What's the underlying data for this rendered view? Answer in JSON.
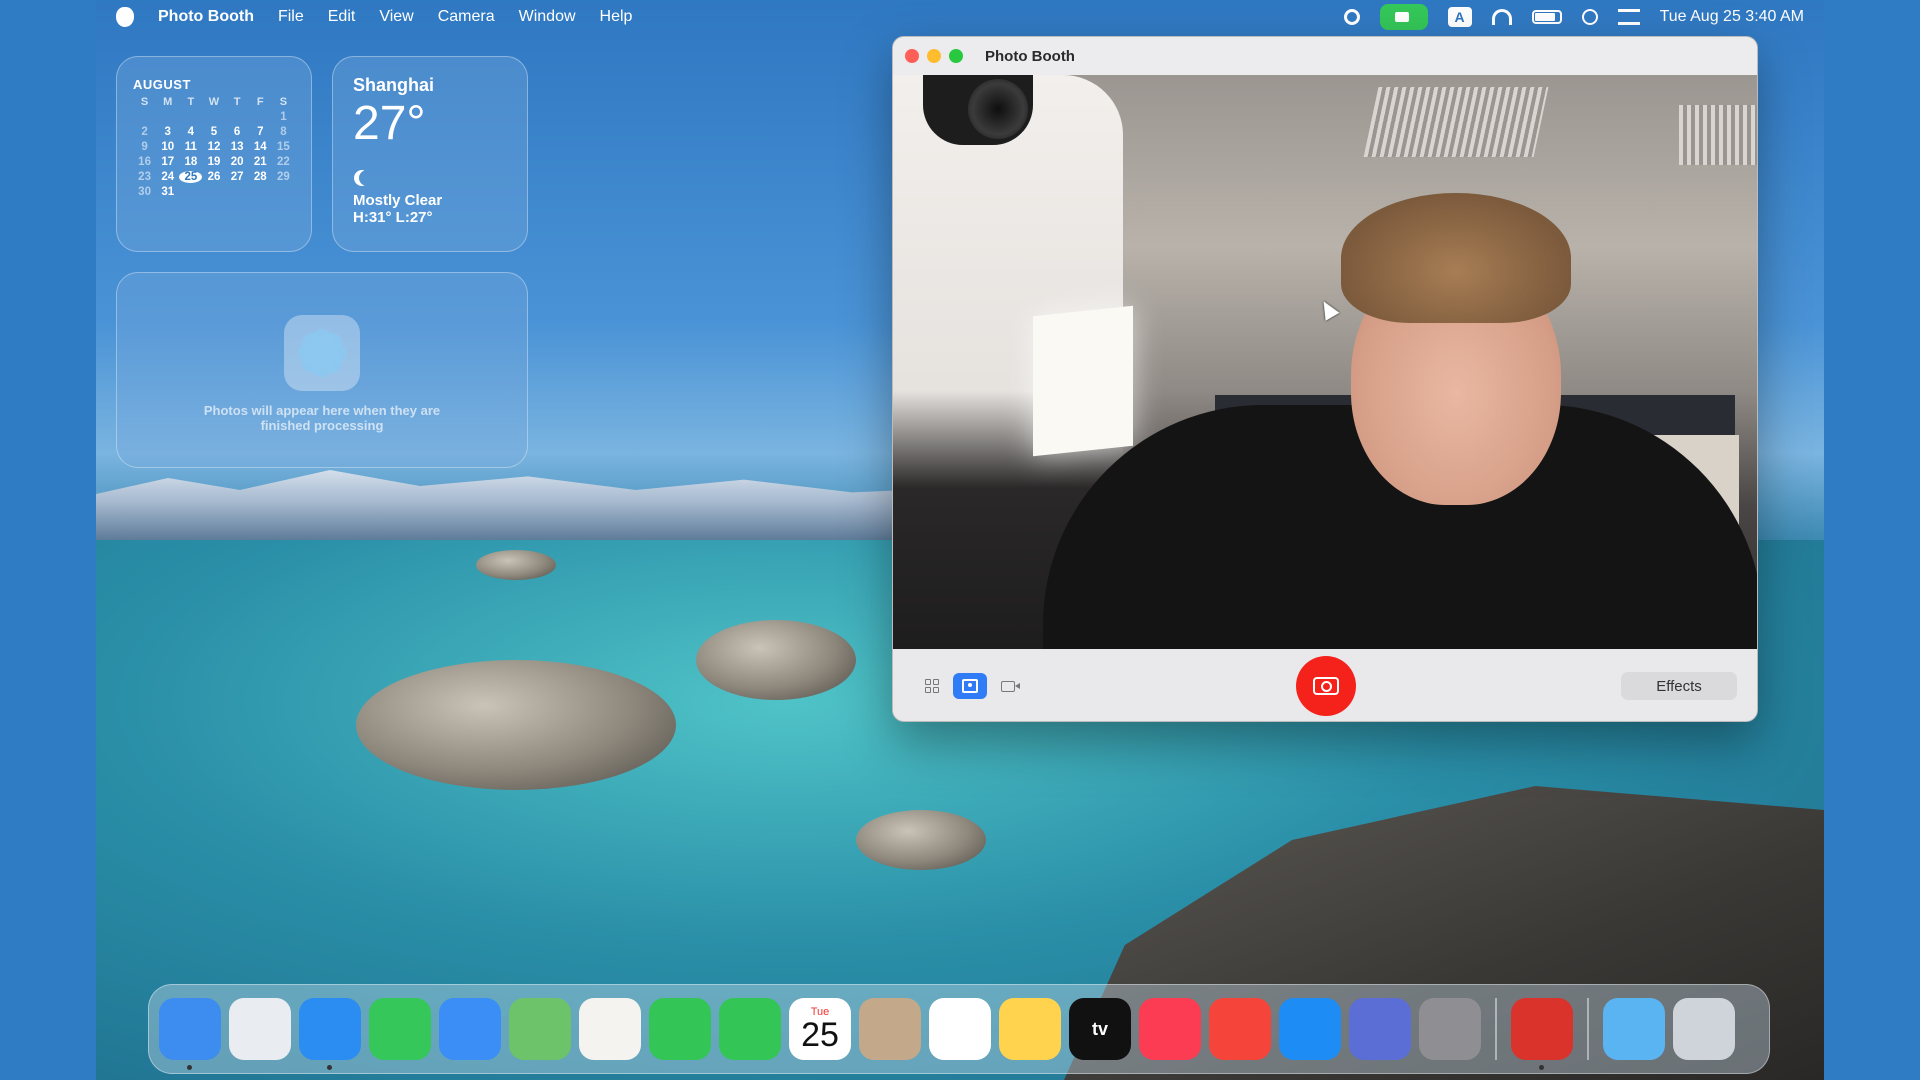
{
  "menubar": {
    "app_name": "Photo Booth",
    "menus": [
      "File",
      "Edit",
      "View",
      "Camera",
      "Window",
      "Help"
    ],
    "keyboard_input": "A",
    "clock": "Tue Aug 25  3:40 AM"
  },
  "calendar_widget": {
    "month": "AUGUST",
    "weekdays": [
      "S",
      "M",
      "T",
      "W",
      "T",
      "F",
      "S"
    ],
    "weeks": [
      [
        "",
        "",
        "",
        "",
        "",
        "",
        "1"
      ],
      [
        "2",
        "3",
        "4",
        "5",
        "6",
        "7",
        "8"
      ],
      [
        "9",
        "10",
        "11",
        "12",
        "13",
        "14",
        "15"
      ],
      [
        "16",
        "17",
        "18",
        "19",
        "20",
        "21",
        "22"
      ],
      [
        "23",
        "24",
        "25",
        "26",
        "27",
        "28",
        "29"
      ],
      [
        "30",
        "31",
        "",
        "",
        "",
        "",
        ""
      ]
    ],
    "today": "25"
  },
  "weather_widget": {
    "city": "Shanghai",
    "temperature": "27°",
    "condition": "Mostly Clear",
    "high_low": "H:31° L:27°"
  },
  "photos_widget": {
    "message": "Photos will appear here when they are finished processing"
  },
  "photo_booth_window": {
    "title": "Photo Booth",
    "effects_label": "Effects",
    "active_view": "single-photo"
  },
  "dock": {
    "apps": [
      {
        "name": "Finder",
        "icon": "finder-icon",
        "color": "#3d8cf0",
        "running": true
      },
      {
        "name": "Launchpad",
        "icon": "launchpad-icon",
        "color": "#e9edf2",
        "running": false
      },
      {
        "name": "Safari",
        "icon": "safari-icon",
        "color": "#2b8cf2",
        "running": true
      },
      {
        "name": "Messages",
        "icon": "messages-icon",
        "color": "#35c759",
        "running": false
      },
      {
        "name": "Mail",
        "icon": "mail-icon",
        "color": "#3a8ef5",
        "running": false
      },
      {
        "name": "Maps",
        "icon": "maps-icon",
        "color": "#6cc36a",
        "running": false
      },
      {
        "name": "Photos",
        "icon": "photos-icon",
        "color": "#f5f3f0",
        "running": false
      },
      {
        "name": "FaceTime",
        "icon": "facetime-icon",
        "color": "#33c656",
        "running": false
      },
      {
        "name": "Phone",
        "icon": "phone-icon",
        "color": "#33c656",
        "running": false
      },
      {
        "name": "Calendar",
        "icon": "calendar-icon",
        "color": "#ffffff",
        "running": false,
        "day": "Tue",
        "date": "25"
      },
      {
        "name": "Contacts",
        "icon": "contacts-icon",
        "color": "#c4a88a",
        "running": false
      },
      {
        "name": "Reminders",
        "icon": "reminders-icon",
        "color": "#ffffff",
        "running": false
      },
      {
        "name": "Notes",
        "icon": "notes-icon",
        "color": "#ffd34d",
        "running": false
      },
      {
        "name": "TV",
        "icon": "tv-icon",
        "color": "#111111",
        "running": false,
        "label": "tv"
      },
      {
        "name": "Music",
        "icon": "music-icon",
        "color": "#fb3c53",
        "running": false
      },
      {
        "name": "Rocket",
        "icon": "rocket-icon",
        "color": "#f5443a",
        "running": false
      },
      {
        "name": "App Store",
        "icon": "app-store-icon",
        "color": "#1d8df5",
        "running": false
      },
      {
        "name": "iPhone Mirroring",
        "icon": "iphone-mirroring-icon",
        "color": "#5a6ed6",
        "running": false
      },
      {
        "name": "System Settings",
        "icon": "system-settings-icon",
        "color": "#8e8e93",
        "running": false
      }
    ],
    "pinned_right": [
      {
        "name": "Photo Booth",
        "icon": "photo-booth-icon",
        "color": "#d9332b",
        "running": true
      }
    ],
    "stacks": [
      {
        "name": "Downloads",
        "icon": "downloads-folder-icon",
        "color": "#5ab4f2"
      },
      {
        "name": "Trash",
        "icon": "trash-icon",
        "color": "#cfd4da"
      }
    ]
  }
}
